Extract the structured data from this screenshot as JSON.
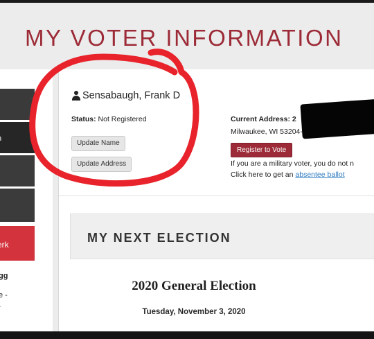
{
  "page_title": "MY VOTER INFORMATION",
  "sidebar": {
    "items": [
      {
        "label": ""
      },
      {
        "label": "n"
      },
      {
        "label": ""
      },
      {
        "label": ""
      },
      {
        "label": "erk"
      }
    ],
    "notes": [
      "gg",
      "e -",
      "-"
    ]
  },
  "voter": {
    "icon": "person-icon",
    "name": "Sensabaugh, Frank D",
    "status_label": "Status:",
    "status_value": "Not Registered",
    "update_name_label": "Update Name",
    "update_address_label": "Update Address"
  },
  "address": {
    "label": "Current Address: 2",
    "city_line": "Milwaukee, WI  53204-1139",
    "register_label": "Register to Vote",
    "military_text": "If you are a military voter, you do not n",
    "absentee_prefix": "Click here to get an ",
    "absentee_link": "absentee ballot"
  },
  "next_election": {
    "heading": "MY NEXT ELECTION",
    "name": "2020 General Election",
    "date": "Tuesday, November 3, 2020"
  },
  "colors": {
    "brand_red": "#9c2b37",
    "active_red": "#d3333d",
    "annotation_red": "#e8232b",
    "link_blue": "#2f7cc2"
  }
}
